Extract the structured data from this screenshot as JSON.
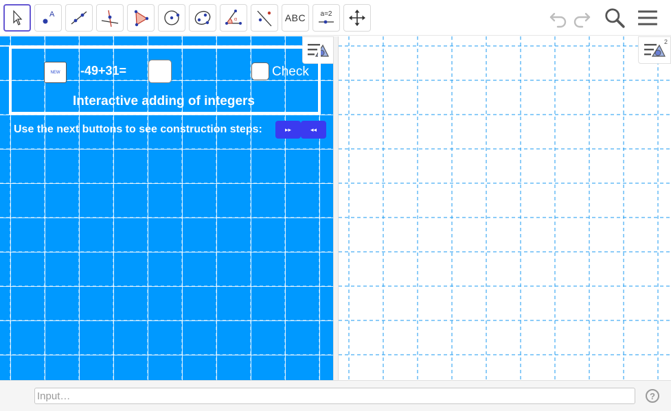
{
  "toolbar": {
    "tools": [
      {
        "name": "move-tool",
        "icon": "cursor-arrow-icon"
      },
      {
        "name": "point-tool",
        "icon": "point-icon"
      },
      {
        "name": "line-tool",
        "icon": "line-icon"
      },
      {
        "name": "perpendicular-tool",
        "icon": "perpendicular-line-icon"
      },
      {
        "name": "polygon-tool",
        "icon": "polygon-icon"
      },
      {
        "name": "circle-tool",
        "icon": "circle-center-icon"
      },
      {
        "name": "ellipse-tool",
        "icon": "ellipse-icon"
      },
      {
        "name": "angle-tool",
        "icon": "angle-icon"
      },
      {
        "name": "reflect-tool",
        "icon": "reflect-icon"
      },
      {
        "name": "text-tool",
        "label": "ABC"
      },
      {
        "name": "slider-tool",
        "label": "a=2"
      },
      {
        "name": "move-graphics-tool",
        "icon": "move-arrows-icon"
      }
    ],
    "undo_icon": "undo-icon",
    "redo_icon": "redo-icon",
    "search_icon": "search-icon",
    "menu_icon": "hamburger-menu-icon"
  },
  "graphics1": {
    "background": "#0099ff",
    "new_button_label": "NEW",
    "equation": "-49+31=",
    "check_label": "Check",
    "box_title": "Interactive adding of integers",
    "steps_text": "Use the next buttons to see construction steps:",
    "next_button_label": "▸▸",
    "prev_button_label": "◂◂",
    "style_bar_icon": "style-bar-icon"
  },
  "graphics2": {
    "style_bar_icon": "style-bar-2-icon",
    "style_bar_superscript": "2"
  },
  "inputbar": {
    "placeholder": "Input…",
    "help_icon_label": "?"
  },
  "colors": {
    "accent": "#6557d2",
    "graphics_bg": "#0099ff",
    "grid": "#1a9af0",
    "nav_button": "#3a3af0"
  }
}
